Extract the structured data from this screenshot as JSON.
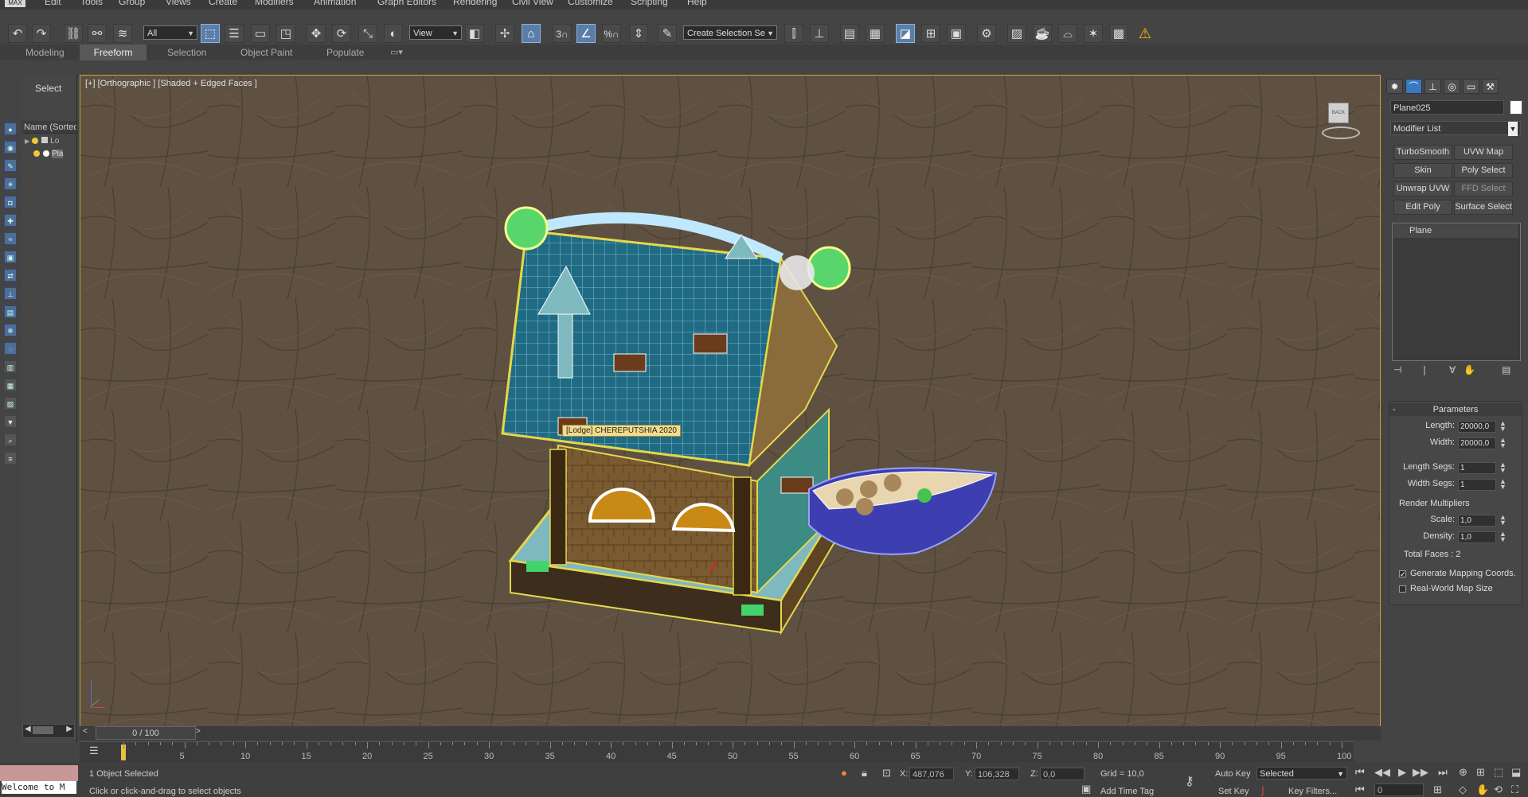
{
  "app": {
    "logo_label": "MAX"
  },
  "menubar": {
    "items": [
      "Edit",
      "Tools",
      "Group",
      "Views",
      "Create",
      "Modifiers",
      "Animation",
      "Graph Editors",
      "Rendering",
      "Civil View",
      "Customize",
      "Scripting",
      "Help"
    ]
  },
  "toolbar": {
    "filter_value": "All",
    "refcoord_value": "View",
    "selection_set_value": "Create Selection Se",
    "snap_label_3": "3",
    "snap_label_pct": "%"
  },
  "ribbon": {
    "tabs": [
      "Modeling",
      "Freeform",
      "Selection",
      "Object Paint",
      "Populate"
    ],
    "active_tab": "Freeform"
  },
  "explorer": {
    "select_label": "Select",
    "column_header": "Name (Sorted",
    "rows": [
      {
        "name": "Lo"
      },
      {
        "name": "Pla"
      }
    ]
  },
  "viewport": {
    "label": "[+] [Orthographic ] [Shaded + Edged Faces ]",
    "tooltip": "[Lodge] CHEREPUTSHIA 2020",
    "viewcube_label": "BACK"
  },
  "command_panel": {
    "object_name": "Plane025",
    "modifier_list_label": "Modifier List",
    "modifier_buttons": [
      "TurboSmooth",
      "UVW Map",
      "Skin",
      "Poly Select",
      "Unwrap UVW",
      "FFD Select",
      "Edit Poly",
      "Surface Select"
    ],
    "stack_item": "Plane",
    "parameters": {
      "title": "Parameters",
      "length_label": "Length:",
      "length_value": "20000,0",
      "width_label": "Width:",
      "width_value": "20000,0",
      "length_segs_label": "Length Segs:",
      "length_segs_value": "1",
      "width_segs_label": "Width Segs:",
      "width_segs_value": "1",
      "render_mult_label": "Render Multipliers",
      "scale_label": "Scale:",
      "scale_value": "1,0",
      "density_label": "Density:",
      "density_value": "1,0",
      "total_faces": "Total Faces : 2",
      "gen_mapping_label": "Generate Mapping Coords.",
      "gen_mapping_checked": "✓",
      "real_world_label": "Real-World Map Size"
    }
  },
  "timeline": {
    "slider_label": "0 / 100",
    "ticks": [
      "5",
      "10",
      "15",
      "20",
      "25",
      "30",
      "35",
      "40",
      "45",
      "50",
      "55",
      "60",
      "65",
      "70",
      "75",
      "80",
      "85",
      "90",
      "95",
      "100"
    ]
  },
  "status": {
    "maxscript_label": "Welcome to M",
    "selected_text": "1 Object Selected",
    "prompt_text": "Click or click-and-drag to select objects",
    "x_label": "X:",
    "x_value": "487,076",
    "y_label": "Y:",
    "y_value": "106,328",
    "z_label": "Z:",
    "z_value": "0,0",
    "grid_text": "Grid = 10,0",
    "add_time_tag": "Add Time Tag",
    "auto_key": "Auto Key",
    "set_key": "Set Key",
    "selected_dropdown": "Selected",
    "key_filters": "Key Filters...",
    "frame_value": "0"
  },
  "colors": {
    "selection_highlight": "#e6d84a",
    "roof": "#1f6b84",
    "ground": "#5e5142",
    "active_tab": "#3879c3"
  }
}
